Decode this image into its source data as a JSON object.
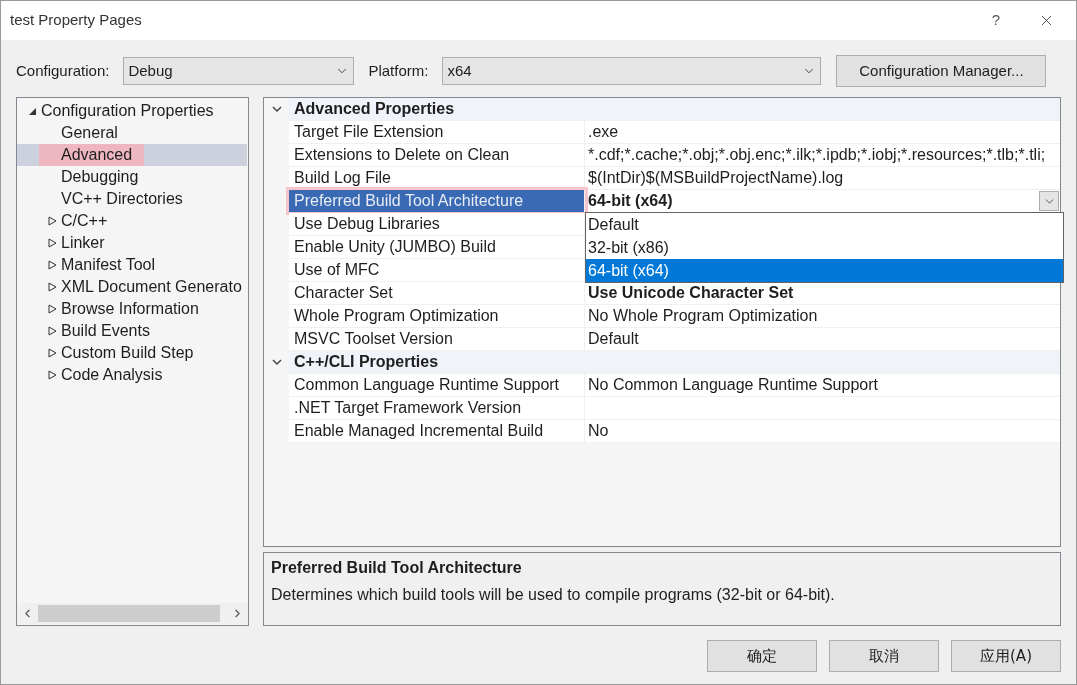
{
  "window": {
    "title": "test Property Pages",
    "help": "?"
  },
  "config_bar": {
    "configuration_label": "Configuration:",
    "configuration": "Debug",
    "platform_label": "Platform:",
    "platform": "x64",
    "manager_button": "Configuration Manager..."
  },
  "tree": {
    "items": [
      {
        "label": "Configuration Properties",
        "kind": "group",
        "expanded": true,
        "selected": false,
        "highlighted": false,
        "children": [
          {
            "label": "General",
            "kind": "page",
            "selected": false,
            "highlighted": false
          },
          {
            "label": "Advanced",
            "kind": "page",
            "selected": true,
            "highlighted": true
          },
          {
            "label": "Debugging",
            "kind": "page",
            "selected": false,
            "highlighted": false
          },
          {
            "label": "VC++ Directories",
            "kind": "page",
            "selected": false,
            "highlighted": false
          },
          {
            "label": "C/C++",
            "kind": "group",
            "expanded": false,
            "selected": false,
            "highlighted": false
          },
          {
            "label": "Linker",
            "kind": "group",
            "expanded": false,
            "selected": false,
            "highlighted": false
          },
          {
            "label": "Manifest Tool",
            "kind": "group",
            "expanded": false,
            "selected": false,
            "highlighted": false
          },
          {
            "label": "XML Document Generato",
            "kind": "group",
            "expanded": false,
            "selected": false,
            "highlighted": false
          },
          {
            "label": "Browse Information",
            "kind": "group",
            "expanded": false,
            "selected": false,
            "highlighted": false
          },
          {
            "label": "Build Events",
            "kind": "group",
            "expanded": false,
            "selected": false,
            "highlighted": false
          },
          {
            "label": "Custom Build Step",
            "kind": "group",
            "expanded": false,
            "selected": false,
            "highlighted": false
          },
          {
            "label": "Code Analysis",
            "kind": "group",
            "expanded": false,
            "selected": false,
            "highlighted": false
          }
        ]
      }
    ]
  },
  "sections": [
    {
      "title": "Advanced Properties",
      "expanded": true,
      "rows": [
        {
          "name": "Target File Extension",
          "value": ".exe",
          "bold": false,
          "selected": false,
          "highlighted": false
        },
        {
          "name": "Extensions to Delete on Clean",
          "value": "*.cdf;*.cache;*.obj;*.obj.enc;*.ilk;*.ipdb;*.iobj;*.resources;*.tlb;*.tli;",
          "bold": false,
          "selected": false,
          "highlighted": false
        },
        {
          "name": "Build Log File",
          "value": "$(IntDir)$(MSBuildProjectName).log",
          "bold": false,
          "selected": false,
          "highlighted": false
        },
        {
          "name": "Preferred Build Tool Architecture",
          "value": "64-bit (x64)",
          "bold": true,
          "selected": true,
          "highlighted": true,
          "dropdown": {
            "options": [
              {
                "label": "Default",
                "selected": false
              },
              {
                "label": "32-bit (x86)",
                "selected": false
              },
              {
                "label": "64-bit (x64)",
                "selected": true
              }
            ]
          }
        },
        {
          "name": "Use Debug Libraries",
          "selected": false,
          "highlighted": false
        },
        {
          "name": "Enable Unity (JUMBO) Build",
          "selected": false,
          "highlighted": false
        },
        {
          "name": "Use of MFC",
          "selected": false,
          "highlighted": false
        },
        {
          "name": "Character Set",
          "value": "Use Unicode Character Set",
          "bold": true,
          "selected": false,
          "highlighted": false
        },
        {
          "name": "Whole Program Optimization",
          "value": "No Whole Program Optimization",
          "bold": false,
          "selected": false,
          "highlighted": false
        },
        {
          "name": "MSVC Toolset Version",
          "value": "Default",
          "bold": false,
          "selected": false,
          "highlighted": false
        }
      ]
    },
    {
      "title": "C++/CLI Properties",
      "expanded": true,
      "rows": [
        {
          "name": "Common Language Runtime Support",
          "value": "No Common Language Runtime Support",
          "bold": false,
          "selected": false,
          "highlighted": false
        },
        {
          "name": ".NET Target Framework Version",
          "selected": false,
          "highlighted": false
        },
        {
          "name": "Enable Managed Incremental Build",
          "value": "No",
          "bold": false,
          "selected": false,
          "highlighted": false
        }
      ]
    }
  ],
  "description": {
    "title": "Preferred Build Tool Architecture",
    "text": "Determines which build tools will be used to compile programs (32-bit or 64-bit)."
  },
  "buttons": [
    "确定",
    "取消",
    "应用(A)"
  ]
}
